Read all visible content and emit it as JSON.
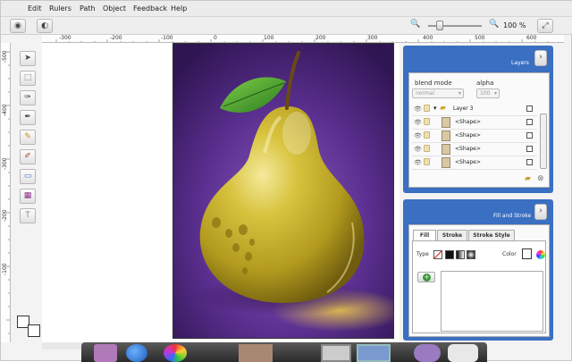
{
  "menu": {
    "items": [
      "Edit",
      "Rulers",
      "Path",
      "Object",
      "Feedback",
      "Help"
    ]
  },
  "toolbar": {
    "zoom_value": "100 %",
    "zoom_fraction": 0.15
  },
  "rulers": {
    "horizontal": [
      "-300",
      "-200",
      "-100",
      "0",
      "100",
      "200",
      "300",
      "400",
      "500",
      "600"
    ],
    "vertical": [
      "-500",
      "-400",
      "-300",
      "-200",
      "-100"
    ]
  },
  "tools": [
    {
      "icon": "select-arrow-icon",
      "glyph": "➤"
    },
    {
      "icon": "node-select-icon",
      "glyph": "⬚"
    },
    {
      "icon": "pen-icon",
      "glyph": "✑"
    },
    {
      "icon": "bezier-pen-icon",
      "glyph": "✒"
    },
    {
      "icon": "pencil-icon",
      "glyph": "✎"
    },
    {
      "icon": "brush-icon",
      "glyph": "🖌"
    },
    {
      "icon": "rectangle-icon",
      "glyph": "▭"
    },
    {
      "icon": "image-icon",
      "glyph": "▦"
    },
    {
      "icon": "text-icon",
      "glyph": "T"
    }
  ],
  "layers_panel": {
    "title": "Layers",
    "blend_mode_label": "blend mode",
    "blend_mode_value": "normal",
    "alpha_label": "alpha",
    "alpha_value": "100",
    "layers": [
      {
        "name": "Layer 3",
        "is_group": true
      },
      {
        "name": "<Shape>",
        "is_group": false
      },
      {
        "name": "<Shape>",
        "is_group": false
      },
      {
        "name": "<Shape>",
        "is_group": false
      },
      {
        "name": "<Shape>",
        "is_group": false
      }
    ]
  },
  "fill_panel": {
    "title": "Fill and Stroke",
    "tabs": [
      "Fill",
      "Stroke",
      "Stroke Style"
    ],
    "type_label": "Type",
    "color_label": "Color"
  },
  "colors": {
    "panel_blue": "#3a6fc2",
    "bg_purple": "#4a2a78",
    "pear_yellow": "#c9b22a",
    "leaf_green": "#3f9a2a"
  }
}
